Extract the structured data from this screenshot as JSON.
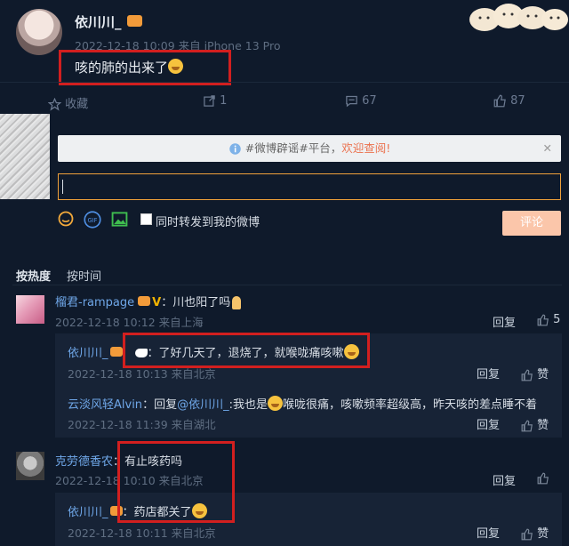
{
  "post": {
    "author": "依川川_",
    "meta": "2022-12-18 10:09 来自 iPhone 13 Pro",
    "text": "咳的肺的出来了"
  },
  "actions": {
    "favorite": "收藏",
    "repost": "1",
    "comments": "67",
    "likes": "87"
  },
  "notice": {
    "prefix": "#微博辟谣#平台，",
    "link": "欢迎查阅!",
    "close": "✕"
  },
  "composer": {
    "repost_label": "同时转发到我的微博",
    "submit": "评论",
    "gif": "GIF"
  },
  "sort": {
    "hot": "按热度",
    "time": "按时间"
  },
  "comments": [
    {
      "user": "榴君-rampage",
      "text": "：川也阳了吗",
      "meta": "2022-12-18 10:12 来自上海",
      "reply": "回复",
      "likes": "5",
      "replies": [
        {
          "user": "依川川_",
          "text": "：了好几天了，退烧了，就喉咙痛咳嗽",
          "meta": "2022-12-18 10:13 来自北京",
          "reply": "回复",
          "like": "赞"
        },
        {
          "user": "云淡风轻Alvin",
          "prefix": "：回复",
          "mention": "@依川川_",
          "text": ":我也是",
          "text2": "喉咙很痛，咳嗽频率超级高，昨天咳的差点睡不着",
          "meta": "2022-12-18 11:39 来自湖北",
          "reply": "回复",
          "like": "赞"
        }
      ]
    },
    {
      "user": "克劳德香农",
      "text": "：有止咳药吗",
      "meta": "2022-12-18 10:10 来自北京",
      "reply": "回复",
      "like": "赞",
      "replies": [
        {
          "user": "依川川_",
          "text": "：药店都关了",
          "meta": "2022-12-18 10:11 来自北京",
          "reply": "回复",
          "like": "赞"
        }
      ]
    }
  ]
}
